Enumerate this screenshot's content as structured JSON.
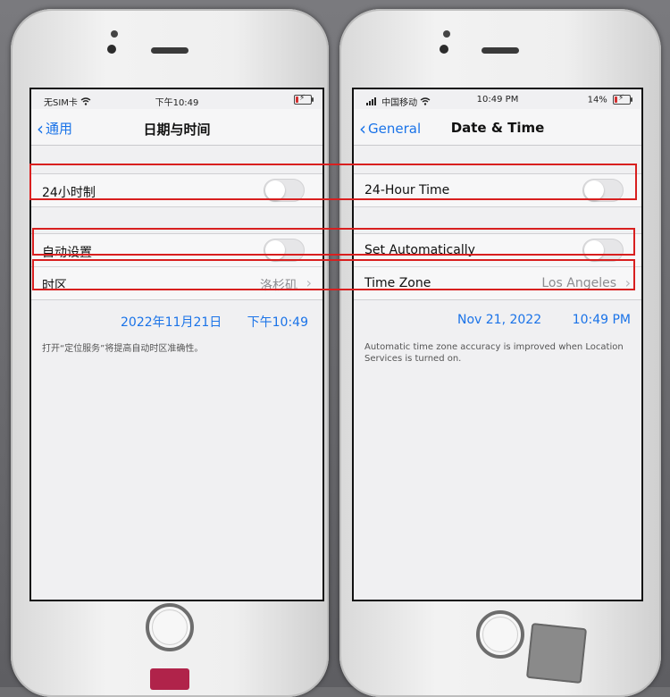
{
  "left_phone": {
    "status": {
      "carrier": "无SIM卡",
      "time": "下午10:49"
    },
    "nav": {
      "back_label": "通用",
      "title": "日期与时间"
    },
    "rows": {
      "hour24_label": "24小时制",
      "set_auto_label": "自动设置",
      "timezone_label": "时区",
      "timezone_value": "洛杉矶"
    },
    "date": "2022年11月21日",
    "time": "下午10:49",
    "note": "打开“定位服务”将提高自动时区准确性。"
  },
  "right_phone": {
    "status": {
      "carrier": "中国移动",
      "time": "10:49 PM",
      "battery": "14%"
    },
    "nav": {
      "back_label": "General",
      "title": "Date & Time"
    },
    "rows": {
      "hour24_label": "24-Hour Time",
      "set_auto_label": "Set Automatically",
      "timezone_label": "Time Zone",
      "timezone_value": "Los Angeles"
    },
    "date": "Nov 21, 2022",
    "time": "10:49 PM",
    "note": "Automatic time zone accuracy is improved when Location Services is turned on."
  },
  "colors": {
    "accent_blue": "#1a73e8",
    "highlight_red": "#d81f1f",
    "battery_low": "#d32f2f"
  },
  "icons": [
    "chevron-left-icon",
    "chevron-right-icon",
    "wifi-icon",
    "cellular-signal-icon",
    "battery-icon",
    "charging-bolt-icon"
  ]
}
